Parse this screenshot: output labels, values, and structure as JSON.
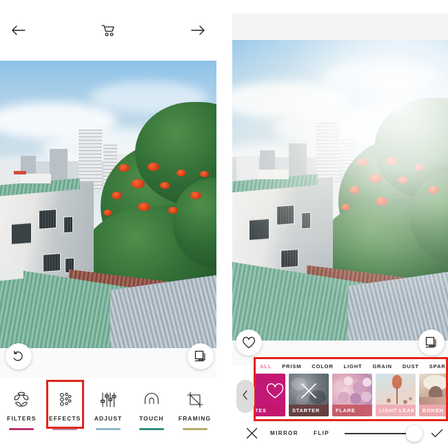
{
  "app": {
    "name": "photo-editor",
    "colors": {
      "accent_red": "#e2231a",
      "accent_magenta": "#c2186f",
      "filters_underline": "#b8306f",
      "effects_underline": "#b58aa8",
      "adjust_underline": "#8fb6cc",
      "touch_underline": "#2e8c7e",
      "framing_underline": "#b5ab6a",
      "category_active": "#e67aa6"
    }
  },
  "left_panel": {
    "topbar": {
      "back_icon": "arrow-left-icon",
      "cart_icon": "shopping-cart-icon",
      "forward_icon": "arrow-right-icon"
    },
    "canvas": {
      "undo_icon": "undo-icon",
      "layers_icon": "layers-icon",
      "photo_description": "city rooftop view with flame tree and cloudy sky"
    },
    "toolbar": [
      {
        "label": "FILTERS",
        "icon": "filters-ring-icon",
        "underline": "#b8306f",
        "selected": false
      },
      {
        "label": "EFFECTS",
        "icon": "effects-dots-icon",
        "underline": "#b58aa8",
        "selected": true
      },
      {
        "label": "ADJUST",
        "icon": "adjust-sliders-icon",
        "underline": "#8fb6cc",
        "selected": false
      },
      {
        "label": "TOUCH",
        "icon": "touch-arch-icon",
        "underline": "#2e8c7e",
        "selected": false
      },
      {
        "label": "FRAMING",
        "icon": "framing-crop-icon",
        "underline": "#b5ab6a",
        "selected": false
      }
    ]
  },
  "right_panel": {
    "canvas": {
      "favorite_icon": "heart-icon",
      "layers_icon": "layers-icon",
      "photo_description": "same rooftop photo with bright light leak effect applied"
    },
    "effects_panel": {
      "collapse_icon": "chevron-left-icon",
      "categories": [
        {
          "label": "ALL",
          "active": true
        },
        {
          "label": "PRISM",
          "active": false
        },
        {
          "label": "COLOR",
          "active": false
        },
        {
          "label": "LIGHT",
          "active": false
        },
        {
          "label": "GRAIN",
          "active": false
        },
        {
          "label": "DUST",
          "active": false
        },
        {
          "label": "SPARKLE",
          "active": false
        }
      ],
      "thumbnails": [
        {
          "label": "RITES",
          "full_label": "FAVORITES",
          "style": "t-fav",
          "icon": "heart-icon"
        },
        {
          "label": "STARTER",
          "full_label": "STARTER",
          "style": "t-starter",
          "icon": "close-x-icon"
        },
        {
          "label": "FLARE",
          "full_label": "FLARE",
          "style": "t-flare",
          "icon": ""
        },
        {
          "label": "LIGHT LEAK",
          "full_label": "LIGHT LEAK",
          "style": "t-leak",
          "icon": ""
        },
        {
          "label": "BOKEH",
          "full_label": "BOKEH",
          "style": "t-bokeh",
          "icon": ""
        }
      ]
    },
    "bottom_bar": {
      "cancel_icon": "close-x-icon",
      "mirror_label": "MIRROR",
      "flip_label": "FLIP",
      "slider_value": 100,
      "confirm_icon": "check-icon"
    }
  }
}
